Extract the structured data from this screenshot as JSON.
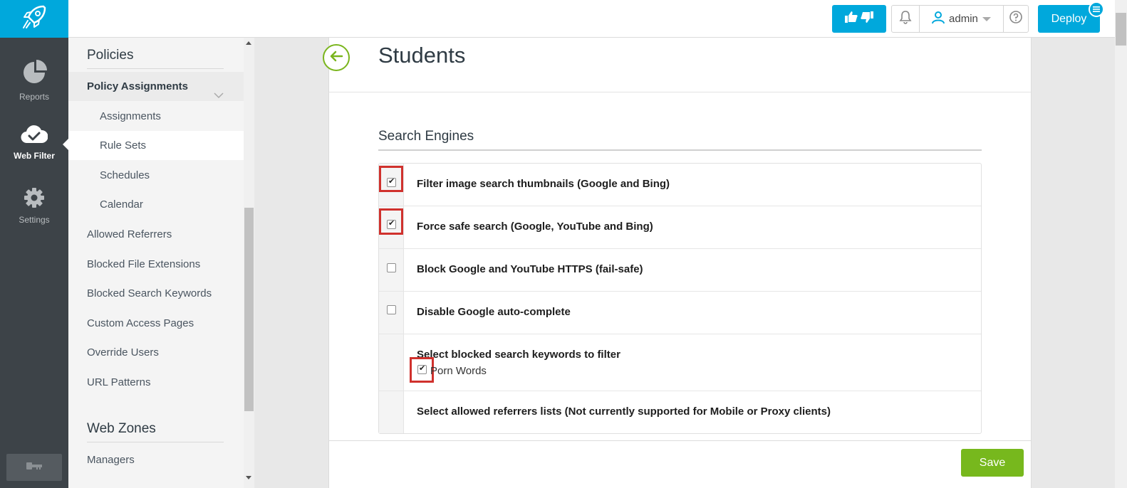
{
  "rail": {
    "items": [
      {
        "label": "Reports",
        "icon": "pie-chart-icon"
      },
      {
        "label": "Web Filter",
        "icon": "cloud-check-icon"
      },
      {
        "label": "Settings",
        "icon": "gear-icon"
      }
    ],
    "bottom_icon": "key-icon",
    "accent": "#00a8dc",
    "background": "#3d4348"
  },
  "topbar": {
    "user": "admin",
    "deploy_label": "Deploy"
  },
  "subnav": {
    "policies_title": "Policies",
    "group_label": "Policy Assignments",
    "sub_items": [
      "Assignments",
      "Rule Sets",
      "Schedules",
      "Calendar"
    ],
    "items": [
      "Allowed Referrers",
      "Blocked File Extensions",
      "Blocked Search Keywords",
      "Custom Access Pages",
      "Override Users",
      "URL Patterns"
    ],
    "web_zones_title": "Web Zones",
    "web_zones_items": [
      "Managers"
    ]
  },
  "main": {
    "title": "Students",
    "section_heading": "Search Engines",
    "options": [
      {
        "label": "Filter image search thumbnails (Google and Bing)",
        "checked": true
      },
      {
        "label": "Force safe search (Google, YouTube and Bing)",
        "checked": true
      },
      {
        "label": "Block Google and YouTube HTTPS (fail-safe)",
        "checked": false
      },
      {
        "label": "Disable Google auto-complete",
        "checked": false
      }
    ],
    "keywords": {
      "label": "Select blocked search keywords to filter",
      "items": [
        {
          "label": "Porn Words",
          "checked": true
        }
      ]
    },
    "referrers_label": "Select allowed referrers lists (Not currently supported for Mobile or Proxy clients)",
    "save_label": "Save",
    "save_color": "#77b81d",
    "highlight_color": "#d0312d"
  }
}
